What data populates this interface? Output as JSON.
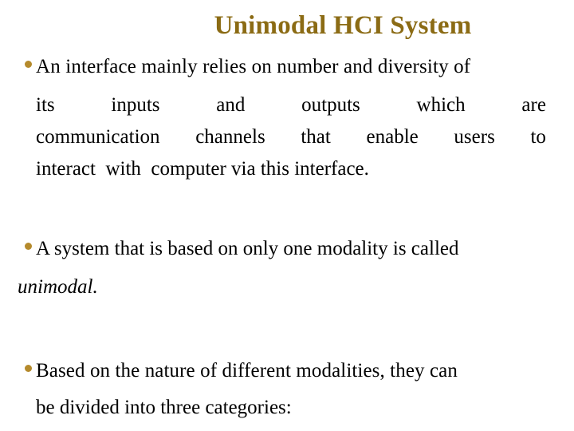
{
  "slide": {
    "title": "Unimodal HCI System",
    "accent_color": "#8B6B14",
    "bullet_color": "#B58A2C",
    "bullets": [
      {
        "lines": [
          "An interface mainly relies on number and diversity of",
          [
            "its",
            "inputs",
            "and",
            "outputs",
            "which",
            "are"
          ],
          [
            "communication",
            "channels",
            "that",
            "enable",
            "users",
            "to"
          ],
          "interact  with  computer via this interface."
        ]
      },
      {
        "lines": [
          "A system that is based on only one modality is called",
          "unimodal."
        ]
      },
      {
        "lines": [
          "Based on the nature of different modalities, they can",
          "be divided into three categories:"
        ]
      }
    ]
  }
}
